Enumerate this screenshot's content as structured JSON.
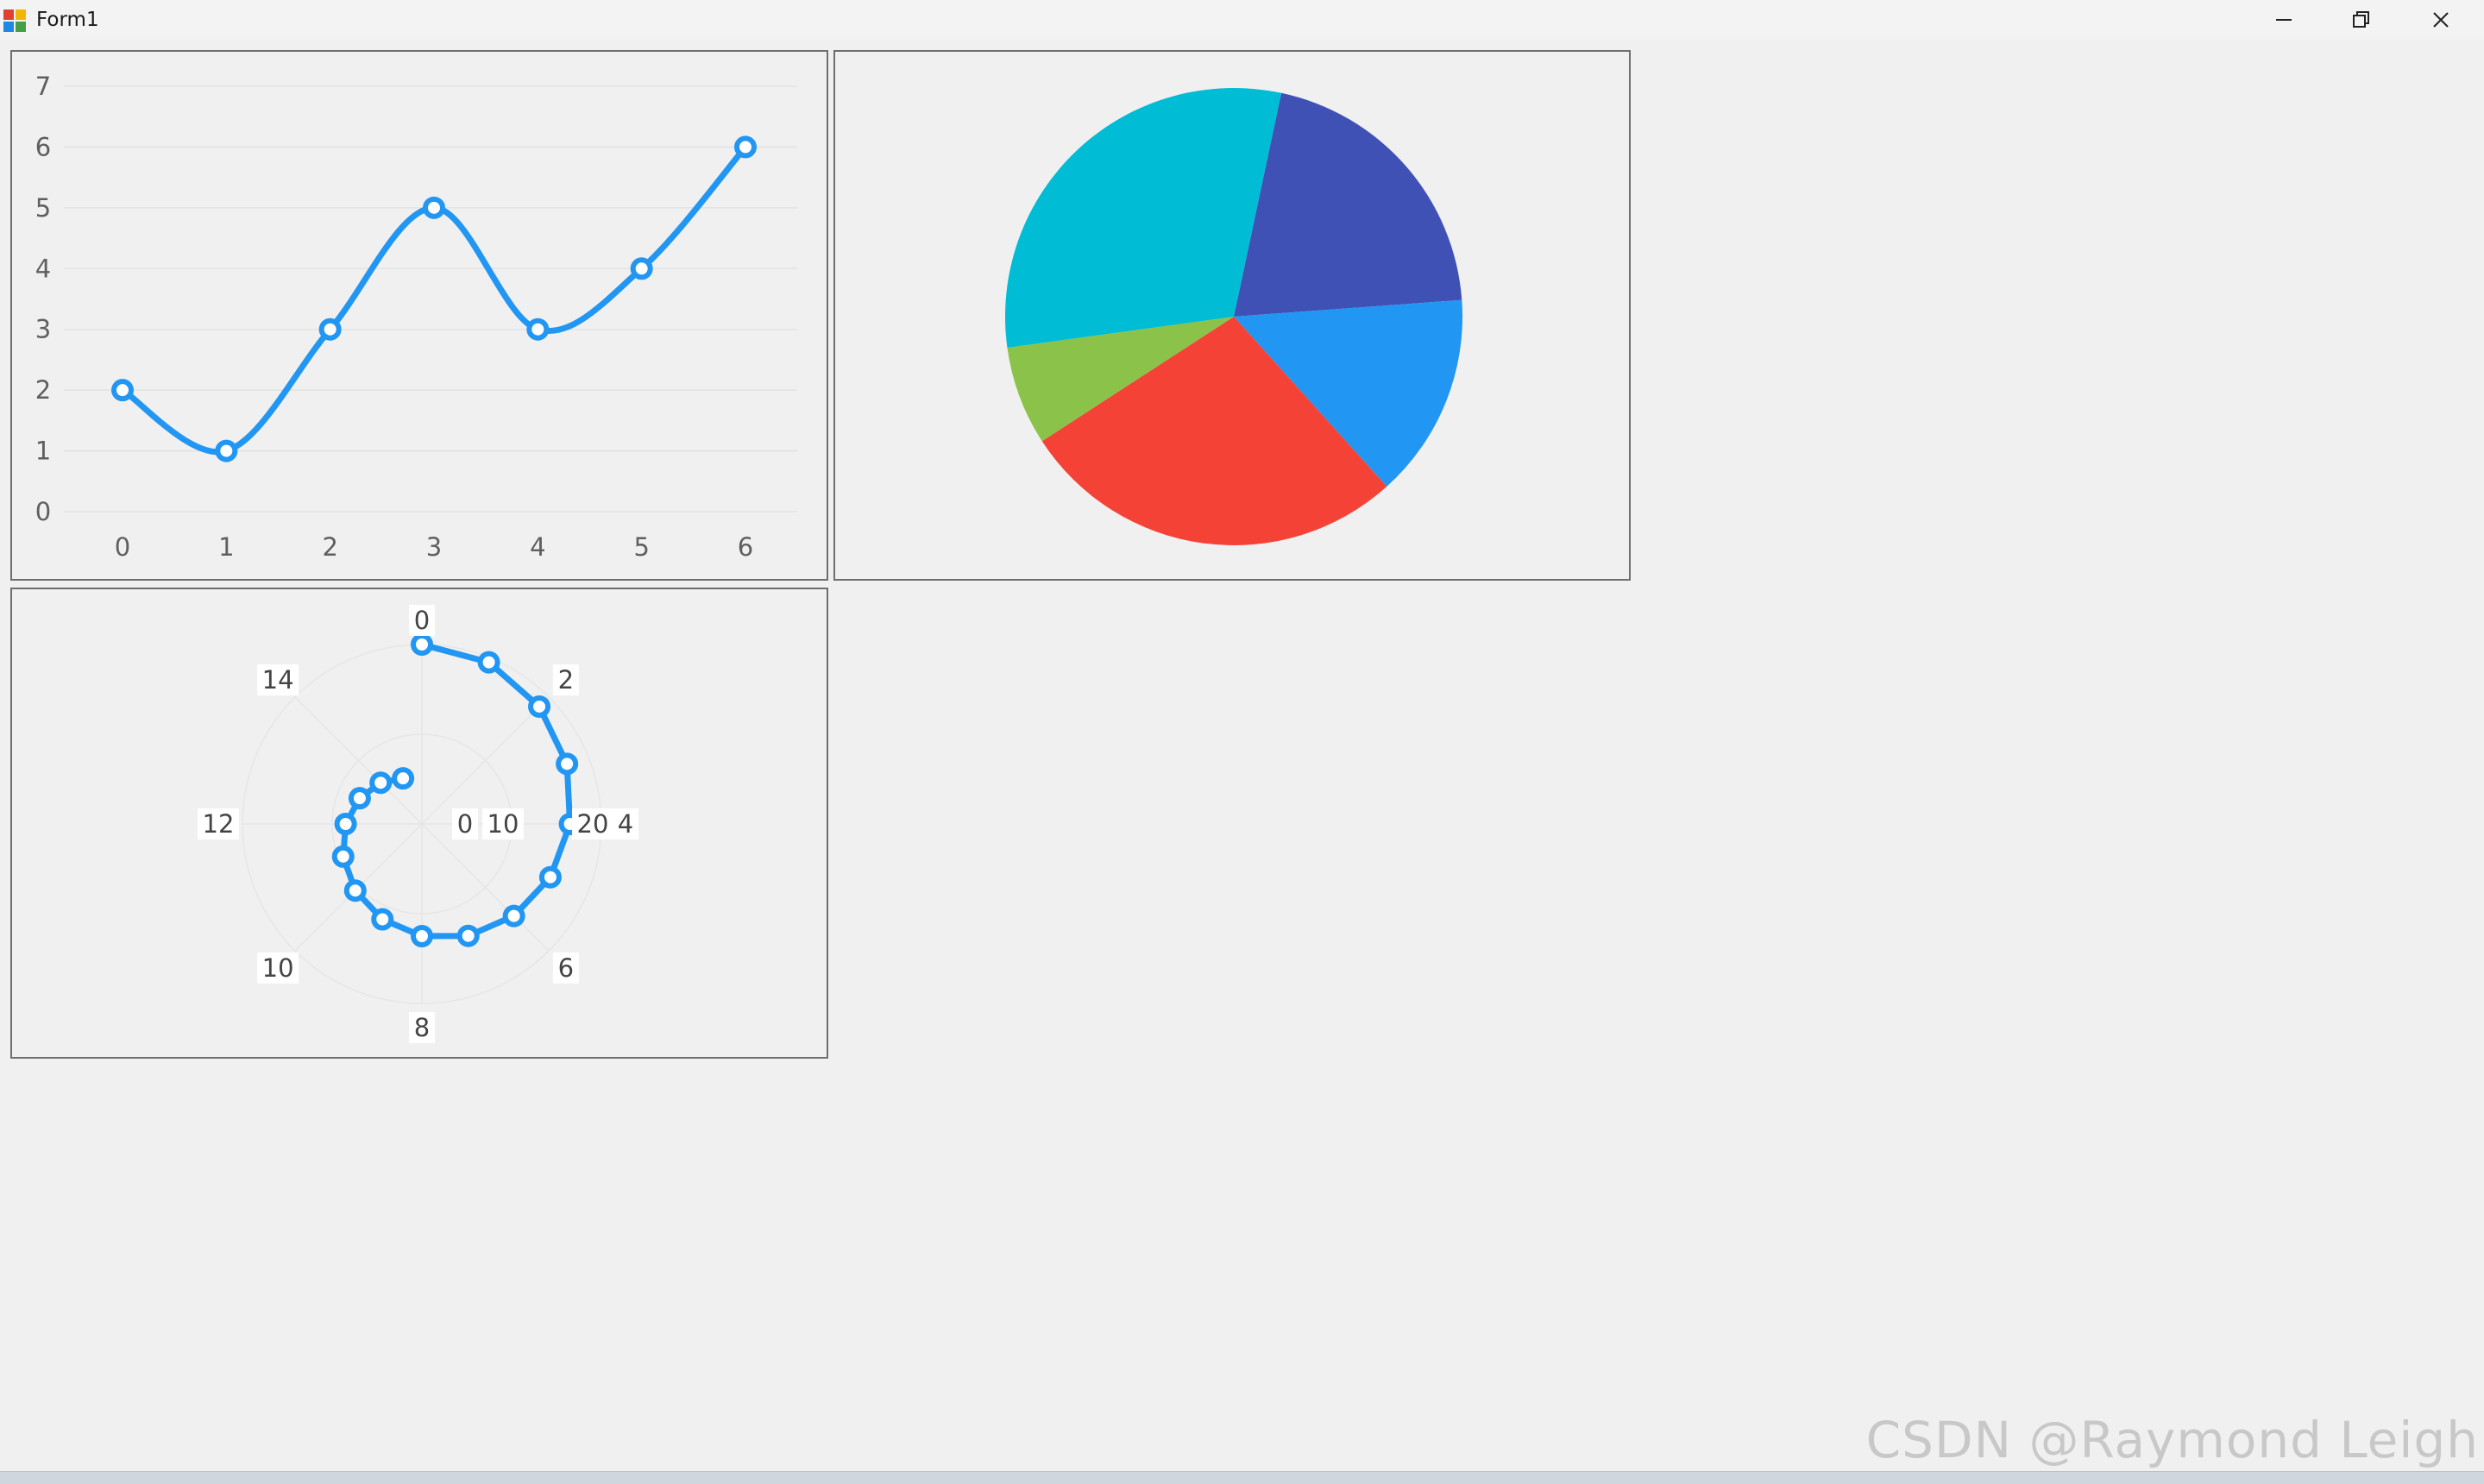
{
  "window": {
    "title": "Form1",
    "controls": [
      "minimize-icon",
      "restore-icon",
      "close-icon"
    ]
  },
  "colors": {
    "series": "#2196f3",
    "grid": "#e2e2e2",
    "tick": "#5f5f5f"
  },
  "watermark": "CSDN @Raymond Leigh",
  "chart_data": [
    {
      "type": "line",
      "x": [
        0,
        1,
        2,
        3,
        4,
        5,
        6
      ],
      "values": [
        2,
        1,
        3,
        5,
        3,
        4,
        6
      ],
      "xlim": [
        0,
        6
      ],
      "ylim": [
        0,
        7
      ],
      "x_ticks": [
        "0",
        "1",
        "2",
        "3",
        "4",
        "5",
        "6"
      ],
      "y_ticks": [
        "0",
        "1",
        "2",
        "3",
        "4",
        "5",
        "6",
        "7"
      ],
      "smooth": true,
      "markers": "hollow-circle",
      "grid": true,
      "color": "#2196f3"
    },
    {
      "type": "pie",
      "values": [
        20.5,
        14.5,
        27.5,
        7,
        30.5
      ],
      "colors": [
        "#3f51b5",
        "#2196f3",
        "#f44336",
        "#8bc34a",
        "#00bcd4"
      ],
      "legend": "none"
    },
    {
      "type": "radar",
      "angle_ticks": [
        "0",
        "2",
        "4",
        "6",
        "8",
        "10",
        "12",
        "14"
      ],
      "angle_max": 16,
      "radial_ticks": [
        "0",
        "10",
        "20"
      ],
      "rlim": [
        0,
        20
      ],
      "r": [
        20,
        19.5,
        18.5,
        17.5,
        16.5,
        15.5,
        14.5,
        13.5,
        12.5,
        11.5,
        10.5,
        9.5,
        8.5,
        7.5,
        6.5,
        5.5
      ],
      "markers": "hollow-circle",
      "color": "#2196f3"
    }
  ]
}
